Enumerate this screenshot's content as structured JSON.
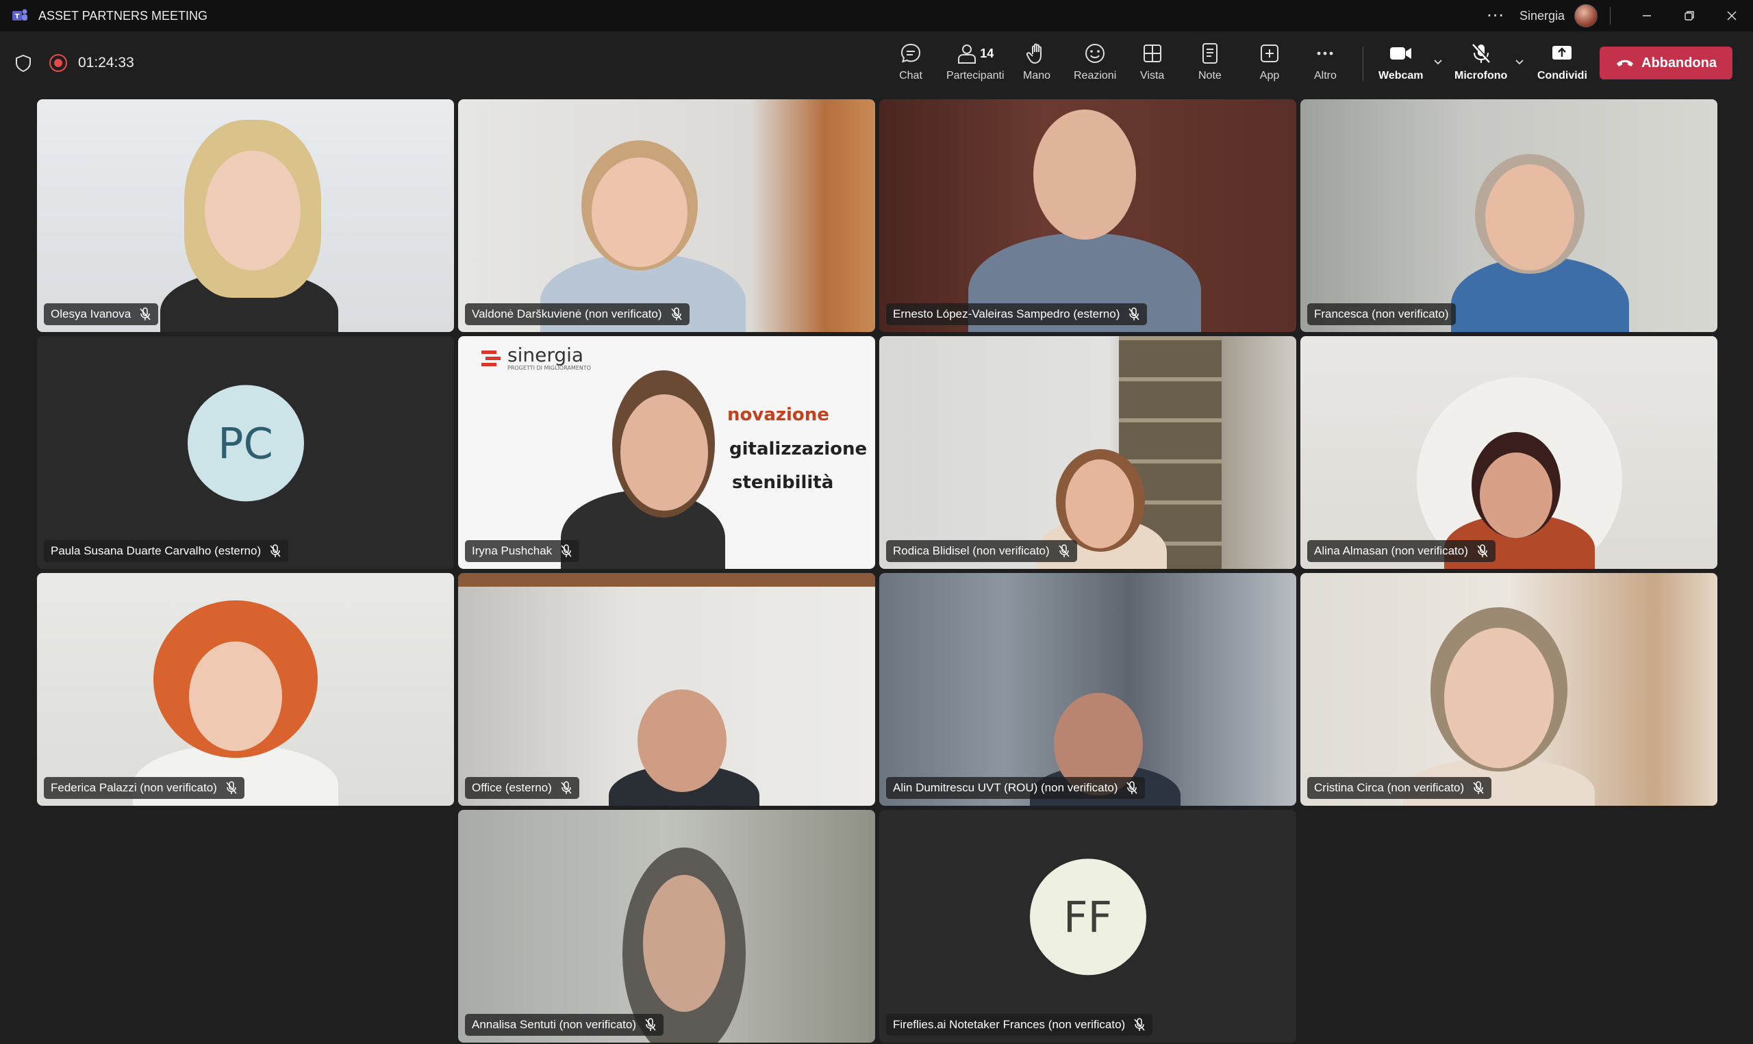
{
  "window": {
    "title": "ASSET PARTNERS MEETING",
    "org_name": "Sinergia",
    "more_label": "···"
  },
  "toolbar": {
    "timer": "01:24:33",
    "chat_label": "Chat",
    "participants_label": "Partecipanti",
    "participants_count": "14",
    "raise_hand_label": "Mano",
    "reactions_label": "Reazioni",
    "view_label": "Vista",
    "notes_label": "Note",
    "apps_label": "App",
    "more_label": "Altro",
    "camera_label": "Webcam",
    "mic_label": "Microfono",
    "share_label": "Condividi",
    "leave_label": "Abbandona",
    "leave_color": "#c4314b"
  },
  "participants": [
    {
      "name": "Olesya Ivanova"
    },
    {
      "name": "Valdonė Darškuvienė (non verificato)"
    },
    {
      "name": "Ernesto López-Valeiras Sampedro (esterno)"
    },
    {
      "name": "Francesca (non verificato)"
    },
    {
      "name": "Paula Susana Duarte Carvalho (esterno)",
      "initials": "PC",
      "avatar_color": "#cce3e8",
      "initials_color": "#2f5f6e"
    },
    {
      "name": "Iryna Pushchak"
    },
    {
      "name": "Rodica Blidisel (non verificato)"
    },
    {
      "name": "Alina Almasan (non verificato)"
    },
    {
      "name": "Federica Palazzi (non verificato)"
    },
    {
      "name": "Office (esterno)"
    },
    {
      "name": "Alin Dumitrescu UVT (ROU) (non verificato)"
    },
    {
      "name": "Cristina Circa (non verificato)"
    },
    {
      "name": "Annalisa Sentuti (non verificato)"
    },
    {
      "name": "Fireflies.ai Notetaker Frances (non verificato)",
      "initials": "FF",
      "avatar_color": "#eef0e2",
      "initials_color": "#3f3f3a"
    }
  ],
  "shared_slide": {
    "brand": "sinergia",
    "brand_sub": "PROGETTI DI MIGLIORAMENTO",
    "line1": "novazione",
    "line2": "gitalizzazione",
    "line3": "stenibilità"
  }
}
